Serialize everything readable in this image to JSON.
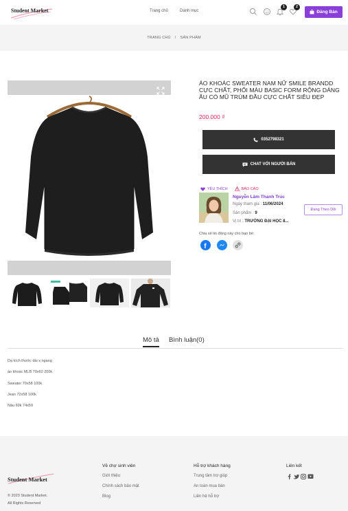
{
  "header": {
    "logo": "Student Market",
    "nav": [
      "Trang chủ",
      "Danh mục"
    ],
    "notification_count": "1",
    "cart_count": "2",
    "sell_button": "Đăng Bán"
  },
  "breadcrumb": {
    "home": "TRANG CHỦ",
    "separator": "/",
    "current": "SẢN PHẨM"
  },
  "product": {
    "title": "ÁO KHOÁC SWEATER NAM NỮ SMILE BRANDD CỰC CHẤT, PHỐI MÀU BASIC FORM RỘNG DÁNG ÂU CÓ MŨ TRÙM ĐẦU CỰC CHẤT SIÊU ĐẸP",
    "price": "200.000 ₫",
    "phone_button": "0352798321",
    "chat_button": "CHAT VỚI NGƯỜI BÁN",
    "like_label": "YÊU THÍCH",
    "report_label": "BÁO CÁO"
  },
  "seller": {
    "name": "Nguyễn Lâm Thanh Trúc",
    "joined_label": "Ngày tham gia :",
    "joined_value": "11/06/2024",
    "products_label": "Sản phẩm :",
    "products_value": "9",
    "location_label": "Vị trí :",
    "location_value": "TRƯỜNG ĐẠI HỌC 8...",
    "follow_button": "Đang Theo Dõi"
  },
  "share": {
    "text": "Chia sẻ tin đăng này cho bạn bè:"
  },
  "tabs": {
    "description": "Mô tả",
    "comments": "Bình luận(0)"
  },
  "description_lines": [
    "Dạ kích thước dài x ngang",
    "áo khoác MLB 70x60 200k",
    "Sweater 70x58 100k",
    "Jean 72x58 100k",
    "Nâu 60k 74x59"
  ],
  "footer": {
    "logo": "Student Market",
    "copyright": "© 2023 Student Market.",
    "rights": "All Rights Reserved",
    "col1": {
      "title": "Về chợ sinh viên",
      "links": [
        "Giới thiệu",
        "Chính sách bảo mật",
        "Blog"
      ]
    },
    "col2": {
      "title": "Hỗ trợ khách hàng",
      "links": [
        "Trung tâm trợ giúp",
        "An toàn mua bán",
        "Liên hệ hỗ trợ"
      ]
    },
    "col3": {
      "title": "Liên kết"
    }
  },
  "colors": {
    "accent": "#8b3fd9",
    "price": "#e0245e",
    "dark_button": "#333333"
  }
}
